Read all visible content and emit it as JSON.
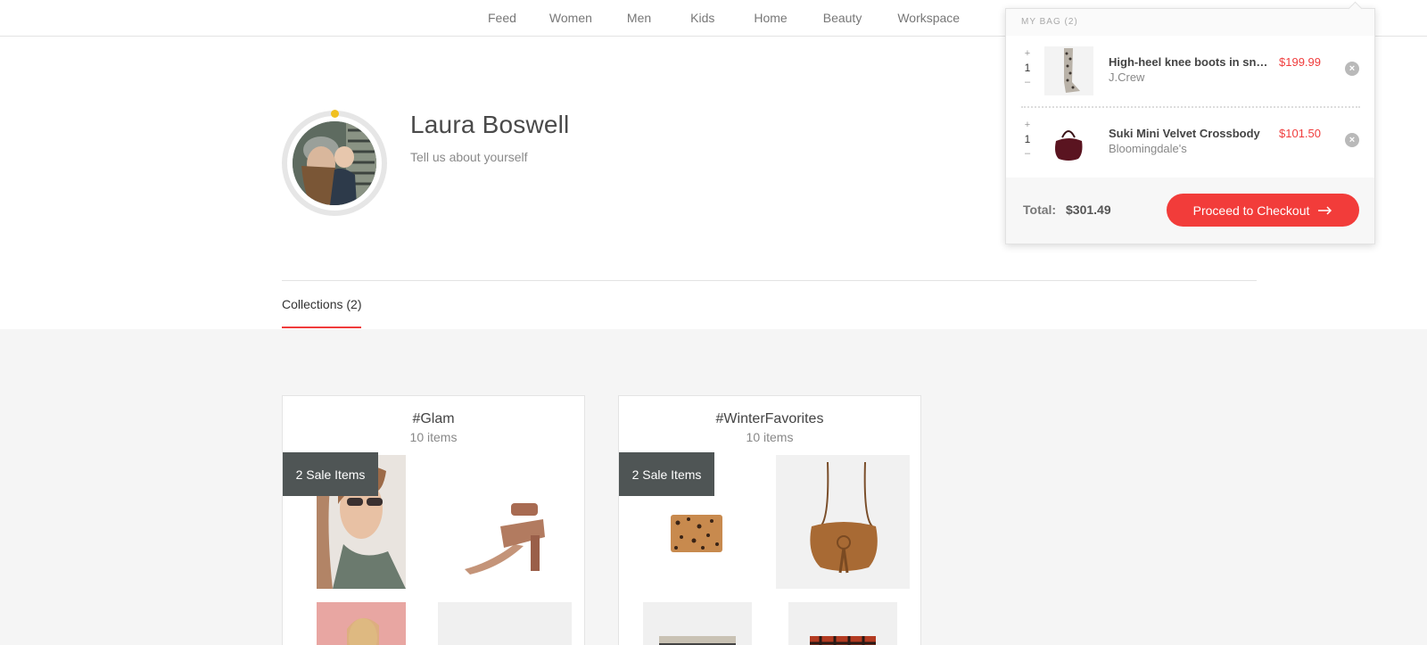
{
  "nav": [
    "Feed",
    "Women",
    "Men",
    "Kids",
    "Home",
    "Beauty",
    "Workspace"
  ],
  "profile": {
    "name": "Laura Boswell",
    "bio": "Tell us about yourself"
  },
  "tabs": [
    {
      "label": "Collections (2)"
    }
  ],
  "collections": [
    {
      "title": "#Glam",
      "count": "10 items",
      "sale": "2 Sale Items"
    },
    {
      "title": "#WinterFavorites",
      "count": "10 items",
      "sale": "2 Sale Items"
    }
  ],
  "bag": {
    "header": "MY BAG (2)",
    "items": [
      {
        "qty": "1",
        "name": "High-heel knee boots in snakeskin",
        "brand": "J.Crew",
        "price": "$199.99"
      },
      {
        "qty": "1",
        "name": "Suki Mini Velvet Crossbody",
        "brand": "Bloomingdale's",
        "price": "$101.50"
      }
    ],
    "total_label": "Total:",
    "total_value": "$301.49",
    "checkout_label": "Proceed to Checkout"
  },
  "colors": {
    "accent": "#f03c3c",
    "sale_badge": "#4f5555"
  }
}
